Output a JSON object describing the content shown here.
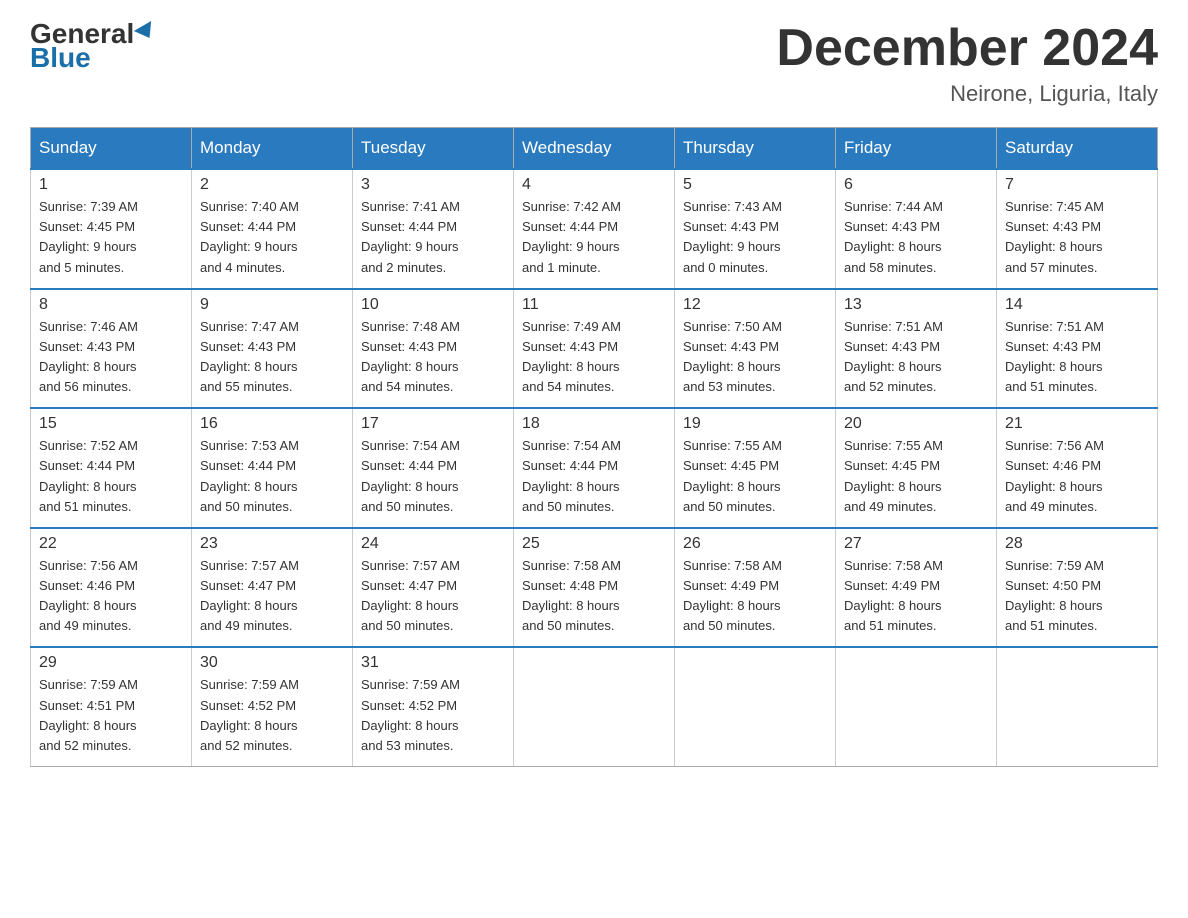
{
  "header": {
    "logo": {
      "general": "General",
      "blue": "Blue",
      "tagline": ""
    },
    "title": "December 2024",
    "location": "Neirone, Liguria, Italy"
  },
  "calendar": {
    "weekdays": [
      "Sunday",
      "Monday",
      "Tuesday",
      "Wednesday",
      "Thursday",
      "Friday",
      "Saturday"
    ],
    "weeks": [
      [
        {
          "day": "1",
          "sunrise": "7:39 AM",
          "sunset": "4:45 PM",
          "daylight": "9 hours and 5 minutes."
        },
        {
          "day": "2",
          "sunrise": "7:40 AM",
          "sunset": "4:44 PM",
          "daylight": "9 hours and 4 minutes."
        },
        {
          "day": "3",
          "sunrise": "7:41 AM",
          "sunset": "4:44 PM",
          "daylight": "9 hours and 2 minutes."
        },
        {
          "day": "4",
          "sunrise": "7:42 AM",
          "sunset": "4:44 PM",
          "daylight": "9 hours and 1 minute."
        },
        {
          "day": "5",
          "sunrise": "7:43 AM",
          "sunset": "4:43 PM",
          "daylight": "9 hours and 0 minutes."
        },
        {
          "day": "6",
          "sunrise": "7:44 AM",
          "sunset": "4:43 PM",
          "daylight": "8 hours and 58 minutes."
        },
        {
          "day": "7",
          "sunrise": "7:45 AM",
          "sunset": "4:43 PM",
          "daylight": "8 hours and 57 minutes."
        }
      ],
      [
        {
          "day": "8",
          "sunrise": "7:46 AM",
          "sunset": "4:43 PM",
          "daylight": "8 hours and 56 minutes."
        },
        {
          "day": "9",
          "sunrise": "7:47 AM",
          "sunset": "4:43 PM",
          "daylight": "8 hours and 55 minutes."
        },
        {
          "day": "10",
          "sunrise": "7:48 AM",
          "sunset": "4:43 PM",
          "daylight": "8 hours and 54 minutes."
        },
        {
          "day": "11",
          "sunrise": "7:49 AM",
          "sunset": "4:43 PM",
          "daylight": "8 hours and 54 minutes."
        },
        {
          "day": "12",
          "sunrise": "7:50 AM",
          "sunset": "4:43 PM",
          "daylight": "8 hours and 53 minutes."
        },
        {
          "day": "13",
          "sunrise": "7:51 AM",
          "sunset": "4:43 PM",
          "daylight": "8 hours and 52 minutes."
        },
        {
          "day": "14",
          "sunrise": "7:51 AM",
          "sunset": "4:43 PM",
          "daylight": "8 hours and 51 minutes."
        }
      ],
      [
        {
          "day": "15",
          "sunrise": "7:52 AM",
          "sunset": "4:44 PM",
          "daylight": "8 hours and 51 minutes."
        },
        {
          "day": "16",
          "sunrise": "7:53 AM",
          "sunset": "4:44 PM",
          "daylight": "8 hours and 50 minutes."
        },
        {
          "day": "17",
          "sunrise": "7:54 AM",
          "sunset": "4:44 PM",
          "daylight": "8 hours and 50 minutes."
        },
        {
          "day": "18",
          "sunrise": "7:54 AM",
          "sunset": "4:44 PM",
          "daylight": "8 hours and 50 minutes."
        },
        {
          "day": "19",
          "sunrise": "7:55 AM",
          "sunset": "4:45 PM",
          "daylight": "8 hours and 50 minutes."
        },
        {
          "day": "20",
          "sunrise": "7:55 AM",
          "sunset": "4:45 PM",
          "daylight": "8 hours and 49 minutes."
        },
        {
          "day": "21",
          "sunrise": "7:56 AM",
          "sunset": "4:46 PM",
          "daylight": "8 hours and 49 minutes."
        }
      ],
      [
        {
          "day": "22",
          "sunrise": "7:56 AM",
          "sunset": "4:46 PM",
          "daylight": "8 hours and 49 minutes."
        },
        {
          "day": "23",
          "sunrise": "7:57 AM",
          "sunset": "4:47 PM",
          "daylight": "8 hours and 49 minutes."
        },
        {
          "day": "24",
          "sunrise": "7:57 AM",
          "sunset": "4:47 PM",
          "daylight": "8 hours and 50 minutes."
        },
        {
          "day": "25",
          "sunrise": "7:58 AM",
          "sunset": "4:48 PM",
          "daylight": "8 hours and 50 minutes."
        },
        {
          "day": "26",
          "sunrise": "7:58 AM",
          "sunset": "4:49 PM",
          "daylight": "8 hours and 50 minutes."
        },
        {
          "day": "27",
          "sunrise": "7:58 AM",
          "sunset": "4:49 PM",
          "daylight": "8 hours and 51 minutes."
        },
        {
          "day": "28",
          "sunrise": "7:59 AM",
          "sunset": "4:50 PM",
          "daylight": "8 hours and 51 minutes."
        }
      ],
      [
        {
          "day": "29",
          "sunrise": "7:59 AM",
          "sunset": "4:51 PM",
          "daylight": "8 hours and 52 minutes."
        },
        {
          "day": "30",
          "sunrise": "7:59 AM",
          "sunset": "4:52 PM",
          "daylight": "8 hours and 52 minutes."
        },
        {
          "day": "31",
          "sunrise": "7:59 AM",
          "sunset": "4:52 PM",
          "daylight": "8 hours and 53 minutes."
        },
        null,
        null,
        null,
        null
      ]
    ]
  }
}
